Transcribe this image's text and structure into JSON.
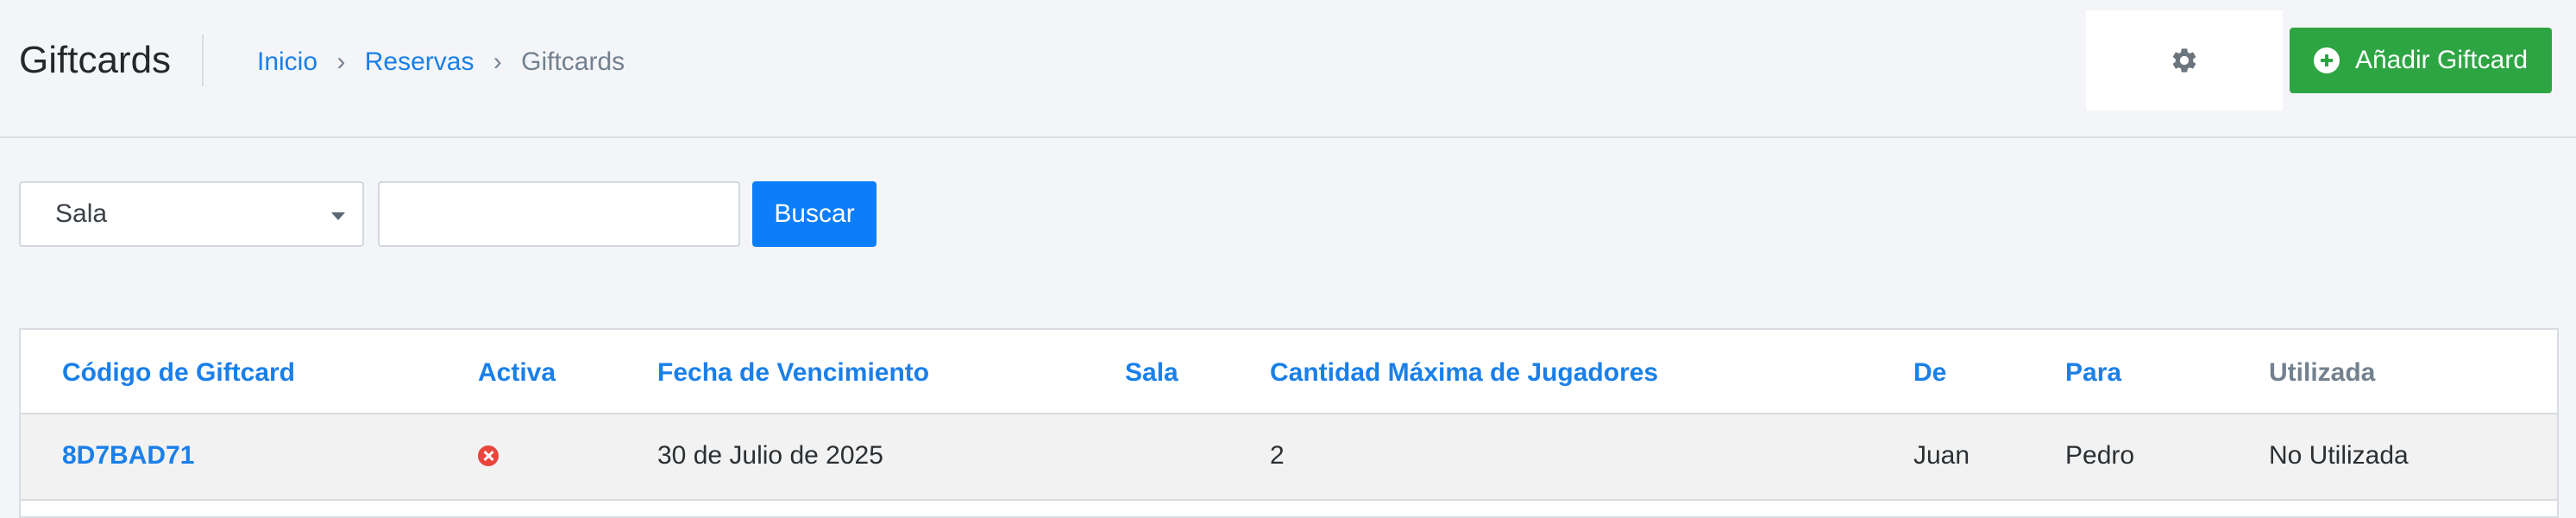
{
  "header": {
    "title": "Giftcards",
    "breadcrumb": [
      {
        "label": "Inicio"
      },
      {
        "label": "Reservas"
      },
      {
        "label": "Giftcards"
      }
    ],
    "breadcrumb_separator": "›",
    "settings_icon": "gear-icon",
    "add_button": {
      "label": "Añadir Giftcard",
      "icon": "plus-circle-icon"
    }
  },
  "filters": {
    "select": {
      "selected": "Sala"
    },
    "search_input": {
      "value": "",
      "placeholder": ""
    },
    "search_button": {
      "label": "Buscar"
    }
  },
  "table": {
    "columns": [
      "Código de Giftcard",
      "Activa",
      "Fecha de Vencimiento",
      "Sala",
      "Cantidad Máxima de Jugadores",
      "De",
      "Para",
      "Utilizada"
    ],
    "rows": [
      {
        "code": "8D7BAD71",
        "active_icon": "inactive-x-icon",
        "expiry": "30 de Julio de 2025",
        "sala": "",
        "max_players": "2",
        "from": "Juan",
        "to": "Pedro",
        "used": "No Utilizada"
      }
    ]
  },
  "colors": {
    "accent": "#1a7fe8",
    "success": "#2ea543",
    "primary_button": "#0d7ef9",
    "inactive": "#e8453c"
  }
}
